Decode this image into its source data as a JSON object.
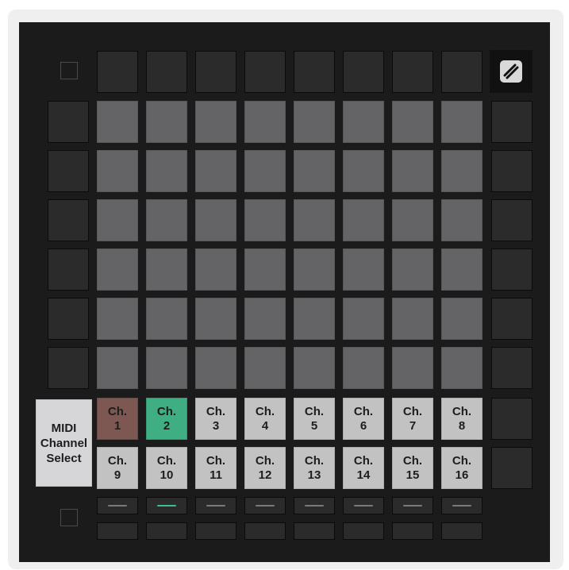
{
  "midi_channel_select": {
    "label": "MIDI\nChannel\nSelect"
  },
  "logo": {
    "icon": "novation-logo-icon"
  },
  "channels_row1": [
    "Ch.\n1",
    "Ch.\n2",
    "Ch.\n3",
    "Ch.\n4",
    "Ch.\n5",
    "Ch.\n6",
    "Ch.\n7",
    "Ch.\n8"
  ],
  "channels_row2": [
    "Ch.\n9",
    "Ch.\n10",
    "Ch.\n11",
    "Ch.\n12",
    "Ch.\n13",
    "Ch.\n14",
    "Ch.\n15",
    "Ch.\n16"
  ],
  "selected_channel_input": "Ch. 1",
  "selected_channel_output": "Ch. 2",
  "colors": {
    "grid_pad": "#646466",
    "channel_pad": "#c2c2c2",
    "selected_input": "#7d5752",
    "selected_output": "#3fae82",
    "device_body": "#1b1b1b"
  }
}
